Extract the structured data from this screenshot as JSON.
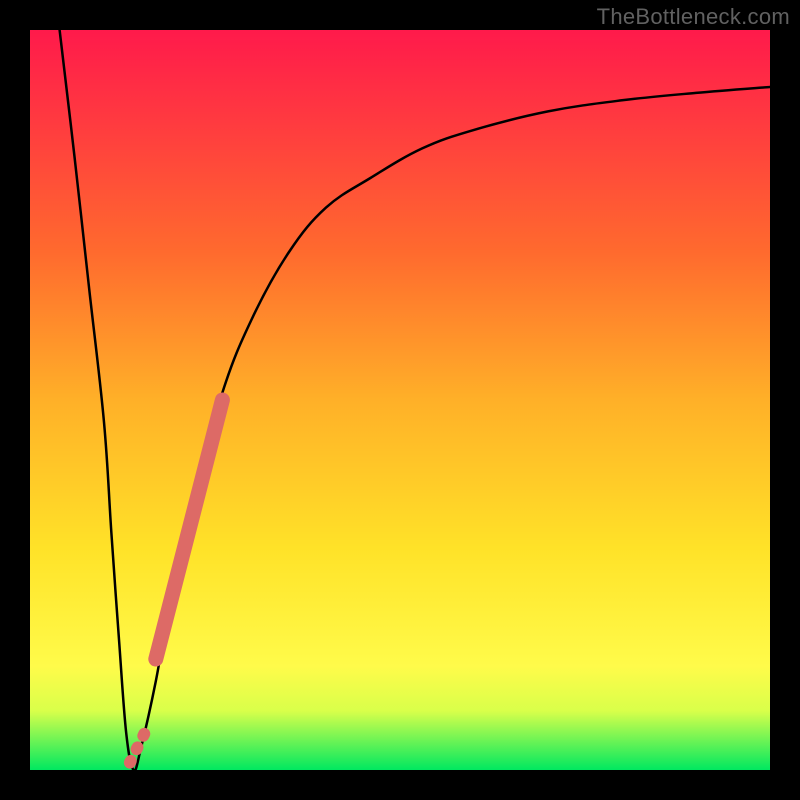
{
  "watermark": "TheBottleneck.com",
  "chart_data": {
    "type": "line",
    "title": "",
    "xlabel": "",
    "ylabel": "",
    "xlim": [
      0,
      100
    ],
    "ylim": [
      0,
      100
    ],
    "series": [
      {
        "name": "bottleneck-curve",
        "x": [
          4,
          6,
          8,
          10,
          11,
          12,
          13,
          14,
          15,
          17,
          19,
          22,
          26,
          30,
          35,
          40,
          46,
          53,
          60,
          70,
          80,
          90,
          100
        ],
        "y": [
          100,
          83,
          65,
          47,
          32,
          18,
          5,
          0,
          3,
          12,
          23,
          36,
          51,
          61,
          70,
          76,
          80,
          84,
          86.5,
          89,
          90.5,
          91.5,
          92.3
        ]
      }
    ],
    "highlight_segments": [
      {
        "name": "salmon-segment-upper",
        "x": [
          17,
          26
        ],
        "y": [
          15,
          50
        ],
        "color": "#dd6a66",
        "width": 15
      },
      {
        "name": "salmon-dots-lower",
        "x": [
          13.5,
          15.5
        ],
        "y": [
          1,
          5
        ],
        "color": "#dd6a66",
        "style": "dotted",
        "width": 12
      }
    ]
  }
}
